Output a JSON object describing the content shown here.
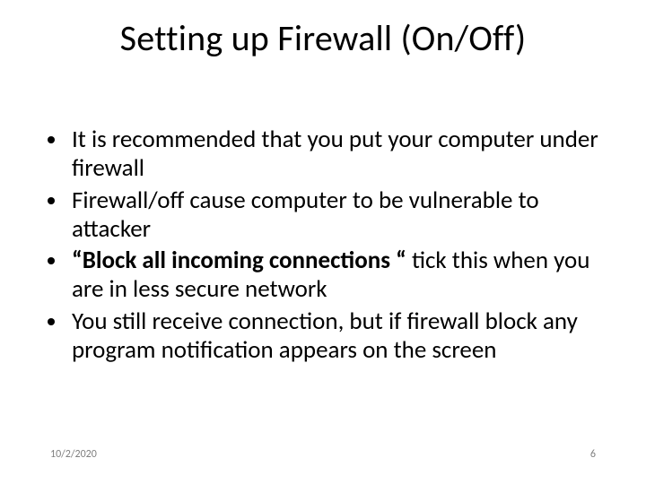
{
  "title": "Setting up Firewall (On/Off)",
  "bullets": [
    {
      "pre": "It is recommended that you put your computer under firewall",
      "bold": "",
      "post": ""
    },
    {
      "pre": "Firewall/off cause computer to be vulnerable to attacker",
      "bold": "",
      "post": ""
    },
    {
      "pre": "",
      "bold": "“Block all incoming connections “ ",
      "post": "tick this when you are in less secure network"
    },
    {
      "pre": "You still receive connection, but if firewall block any program notification appears  on the screen",
      "bold": "",
      "post": ""
    }
  ],
  "footer": {
    "date": "10/2/2020",
    "page": "6"
  }
}
